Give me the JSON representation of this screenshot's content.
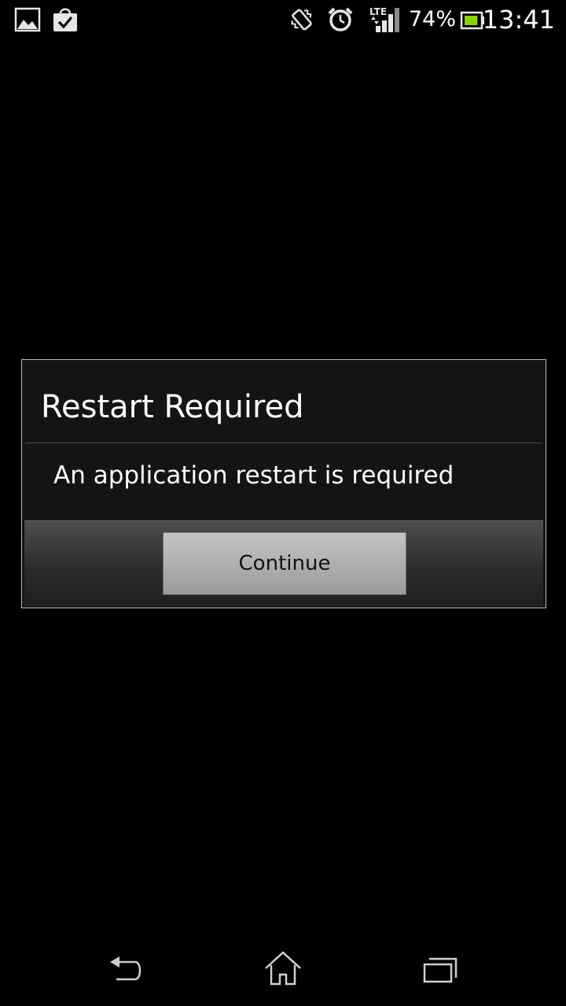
{
  "status_bar": {
    "icons_left": [
      "gallery-icon",
      "play-store-icon"
    ],
    "icons_right": [
      "vibrate-icon",
      "alarm-clock-icon",
      "lte-signal-icon",
      "battery-icon"
    ],
    "network_label": "LTE",
    "battery_percent": "74%",
    "battery_level": 0.74,
    "time": "13:41"
  },
  "dialog": {
    "title": "Restart Required",
    "message": "An application restart is required",
    "continue_label": "Continue"
  },
  "nav_bar": {
    "icons": [
      "back-icon",
      "home-icon",
      "recent-apps-icon"
    ]
  },
  "colors": {
    "background": "#000000",
    "dialog_background": "#141414",
    "dialog_border": "#bdbdbd",
    "text": "#ffffff",
    "battery_fill": "#8fd400"
  }
}
